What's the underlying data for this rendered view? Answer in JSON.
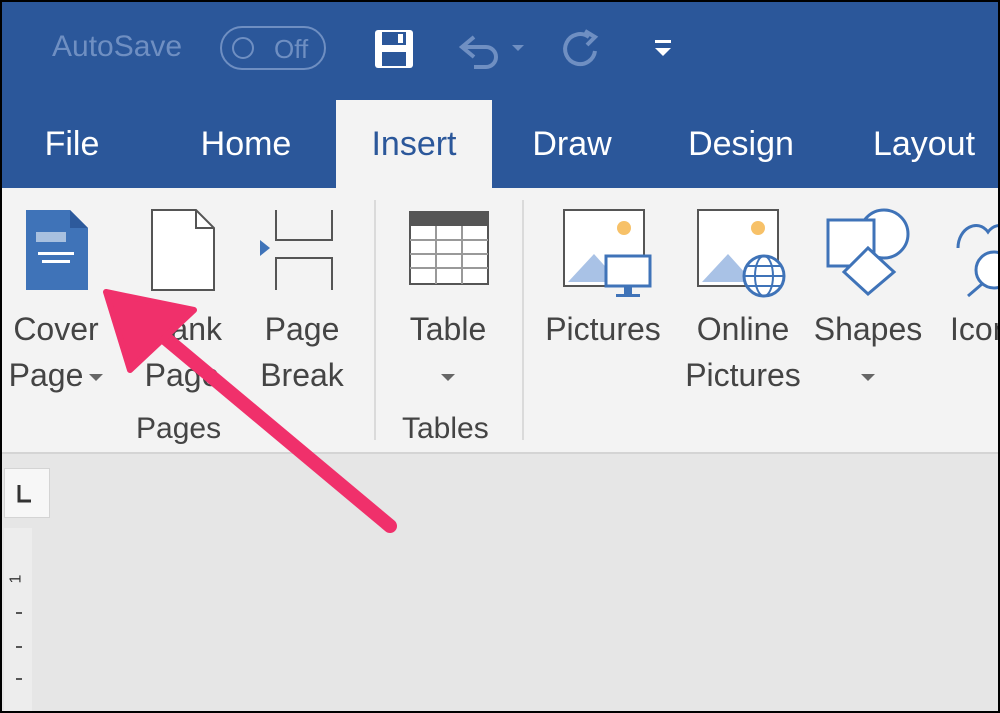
{
  "titlebar": {
    "autosave_label": "AutoSave",
    "autosave_state": "Off",
    "save_icon": "save-icon",
    "undo_icon": "undo-icon",
    "redo_icon": "redo-icon",
    "customize_icon": "customize-qat-icon"
  },
  "tabs": [
    "File",
    "Home",
    "Insert",
    "Draw",
    "Design",
    "Layout"
  ],
  "active_tab": "Insert",
  "ribbon": {
    "pages": {
      "group_label": "Pages",
      "cover_page": {
        "line1": "Cover",
        "line2": "Page"
      },
      "blank_page": {
        "line1": "Blank",
        "line2": "Page"
      },
      "page_break": {
        "line1": "Page",
        "line2": "Break"
      }
    },
    "tables": {
      "group_label": "Tables",
      "table": {
        "line1": "Table"
      }
    },
    "illustrations": {
      "pictures": {
        "line1": "Pictures"
      },
      "online_pictures": {
        "line1": "Online",
        "line2": "Pictures"
      },
      "shapes": {
        "line1": "Shapes"
      },
      "icons": {
        "line1": "Icons"
      }
    }
  },
  "ruler": {
    "tab_selector": "L",
    "marker": "1"
  },
  "colors": {
    "brand": "#2b579a",
    "arrow": "#f0306b",
    "icon_blue": "#3f73b8",
    "icon_orange": "#f7c168"
  }
}
